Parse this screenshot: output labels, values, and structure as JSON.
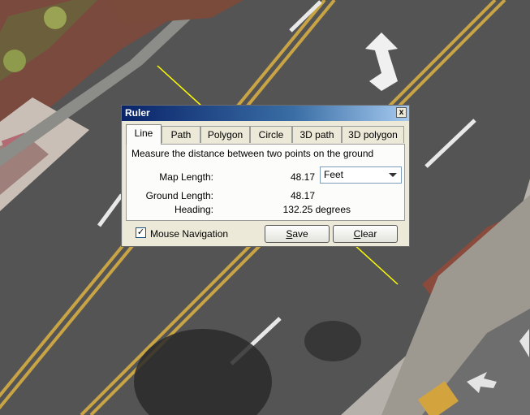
{
  "window": {
    "title": "Ruler",
    "close_glyph": "x"
  },
  "tabs": [
    {
      "label": "Line",
      "active": true
    },
    {
      "label": "Path",
      "active": false
    },
    {
      "label": "Polygon",
      "active": false
    },
    {
      "label": "Circle",
      "active": false
    },
    {
      "label": "3D path",
      "active": false
    },
    {
      "label": "3D polygon",
      "active": false
    }
  ],
  "panel": {
    "description": "Measure the distance between two points on the ground",
    "map_length_label": "Map Length:",
    "map_length_value": "48.17",
    "unit_selected": "Feet",
    "ground_length_label": "Ground Length:",
    "ground_length_value": "48.17",
    "heading_label": "Heading:",
    "heading_value": "132.25 degrees"
  },
  "footer": {
    "mouse_navigation_label": "Mouse Navigation",
    "mouse_navigation_checked": true,
    "check_glyph": "✓",
    "save_first": "S",
    "save_rest": "ave",
    "clear_first": "C",
    "clear_rest": "lear"
  },
  "colors": {
    "measure_line": "#ffff00",
    "title_bar": "#0a246a",
    "dialog_face": "#ece9d8"
  }
}
